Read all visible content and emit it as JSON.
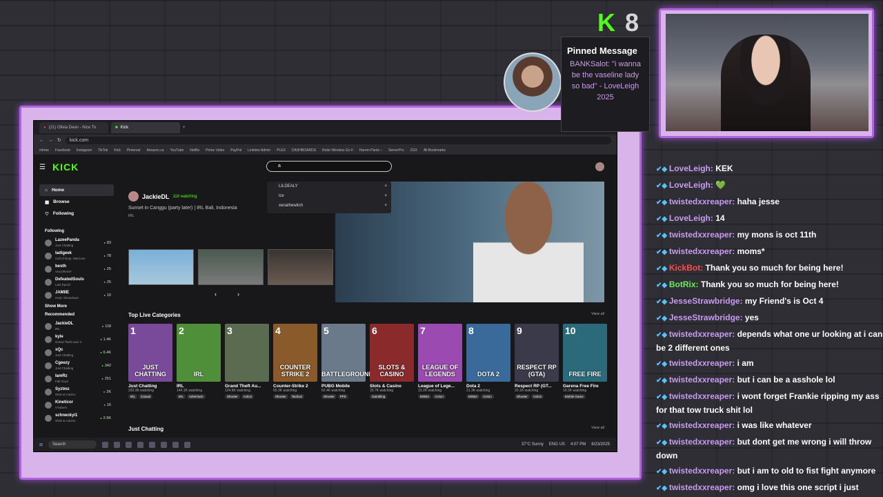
{
  "overlay": {
    "kick_logo_letter": "K",
    "viewer_count": "8",
    "pinned": {
      "title": "Pinned Message",
      "text": "BANKSalot: \"i wanna be the vaseline lady so bad\" - LoveLeigh 2025"
    }
  },
  "browser": {
    "tabs": [
      {
        "label": "(21) Olivia Dean - Nice To"
      },
      {
        "label": "Kick"
      }
    ],
    "url": "kick.com",
    "bookmarks": [
      "mhme",
      "Facebook",
      "Instagram",
      "TikTok",
      "Kick",
      "Pinterest",
      "Amazon.ca",
      "YouTube",
      "Netflix",
      "Prime Video",
      "PayPal",
      "Linktree Admin",
      "PLEX",
      "DASHBOARDS",
      "Rode Wireless Go II",
      "Harem Pants –",
      "ServerPro",
      "ZGX",
      "All Bookmarks"
    ]
  },
  "kick": {
    "logo": "KICK",
    "search_value": "a",
    "search_suggestions": [
      "LILDEALY",
      "ice",
      "xenathewitch"
    ],
    "nav": [
      "Home",
      "Browse",
      "Following"
    ],
    "following_header": "Following",
    "following": [
      {
        "name": "LazeePanda",
        "game": "Just Chatting",
        "count": "83"
      },
      {
        "name": "ladigeek",
        "game": "Call of Duty: Warzone",
        "count": "78"
      },
      {
        "name": "besth",
        "game": "VALORANT",
        "count": "25"
      },
      {
        "name": "DefeatedSouls",
        "game": "Last Epoch",
        "count": "25"
      },
      {
        "name": "JAMIIE",
        "game": "Hunt: Showdown",
        "count": "10"
      }
    ],
    "show_more": "Show More",
    "recommended_header": "Recommended",
    "recommended": [
      {
        "name": "JackieDL",
        "game": "IRL",
        "count": "118"
      },
      {
        "name": "kyle",
        "game": "Grand Theft Auto V",
        "count": "1.4K"
      },
      {
        "name": "xQc",
        "game": "Just Chatting",
        "count": "6.4K"
      },
      {
        "name": "Cgeezy",
        "game": "Just Chatting",
        "count": "342"
      },
      {
        "name": "IamRz",
        "game": "Fall Guys",
        "count": "251"
      },
      {
        "name": "Syztmz",
        "game": "Slots & Casino",
        "count": "2K"
      },
      {
        "name": "Kineticor",
        "game": "VTubers",
        "count": "16"
      },
      {
        "name": "schneckyi1",
        "game": "Slots & Casino",
        "count": "2.9K"
      }
    ],
    "featured": {
      "streamer": "JackieDL",
      "watching": "118 watching",
      "title": "Sunset in Canggu (party later) | IRL Bali, Indonesia",
      "category": "IRL"
    },
    "top_categories_title": "Top Live Categories",
    "view_all": "View all",
    "categories": [
      {
        "rank": "1",
        "art": "JUST CHATTING",
        "name": "Just Chatting",
        "viewers": "220.3K watching",
        "tags": [
          "IRL",
          "Casual"
        ],
        "color": "#7a4a9a"
      },
      {
        "rank": "2",
        "art": "IRL",
        "name": "IRL",
        "viewers": "144.1K watching",
        "tags": [
          "IRL",
          "Adventure"
        ],
        "color": "#4f8f3a"
      },
      {
        "rank": "3",
        "art": "",
        "name": "Grand Theft Au...",
        "viewers": "124.8K watching",
        "tags": [
          "Shooter",
          "Action"
        ],
        "color": "#5a6b50"
      },
      {
        "rank": "4",
        "art": "COUNTER STRIKE 2",
        "name": "Counter-Strike 2",
        "viewers": "65.3K watching",
        "tags": [
          "Shooter",
          "Tactical"
        ],
        "color": "#8a5a2a"
      },
      {
        "rank": "5",
        "art": "BATTLEGROUNDS",
        "name": "PUBG Mobile",
        "viewers": "62.4K watching",
        "tags": [
          "Shooter",
          "FPS"
        ],
        "color": "#6b7a8a"
      },
      {
        "rank": "6",
        "art": "SLOTS & CASINO",
        "name": "Slots & Casino",
        "viewers": "33.7K watching",
        "tags": [
          "Gambling"
        ],
        "color": "#8a2a2a"
      },
      {
        "rank": "7",
        "art": "LEAGUE OF LEGENDS",
        "name": "League of Lege...",
        "viewers": "33.2K watching",
        "tags": [
          "MOBA",
          "Action"
        ],
        "color": "#9a4ab0"
      },
      {
        "rank": "8",
        "art": "DOTA 2",
        "name": "Dota 2",
        "viewers": "21.3K watching",
        "tags": [
          "MOBA",
          "Action"
        ],
        "color": "#3a6a9a"
      },
      {
        "rank": "9",
        "art": "RESPECT RP (GTA)",
        "name": "Respect RP (GT...",
        "viewers": "20.1K watching",
        "tags": [
          "Shooter",
          "Action"
        ],
        "color": "#3a3a4a"
      },
      {
        "rank": "10",
        "art": "FREE FIRE",
        "name": "Garena Free Fire",
        "viewers": "19.2K watching",
        "tags": [
          "Mobile Game"
        ],
        "color": "#2a6a7a"
      }
    ],
    "just_chatting_title": "Just Chatting"
  },
  "taskbar": {
    "search": "Search",
    "weather": "37°C Sunny",
    "lang": "ENG US",
    "time": "4:07 PM",
    "date": "8/23/2025"
  },
  "chat": [
    {
      "user": "LoveLeigh:",
      "text": "KEK",
      "cls": ""
    },
    {
      "user": "LoveLeigh:",
      "text": "💚",
      "cls": ""
    },
    {
      "user": "twistedxxreaper:",
      "text": "haha jesse",
      "cls": ""
    },
    {
      "user": "LoveLeigh:",
      "text": "14",
      "cls": ""
    },
    {
      "user": "twistedxxreaper:",
      "text": "my mons is oct 11th",
      "cls": ""
    },
    {
      "user": "twistedxxreaper:",
      "text": "moms*",
      "cls": ""
    },
    {
      "user": "KickBot:",
      "text": "Thank you so much for being here!",
      "cls": "red"
    },
    {
      "user": "BotRix:",
      "text": "Thank you so much for being here!",
      "cls": "green"
    },
    {
      "user": "JesseStrawbridge:",
      "text": "my Friend's is Oct 4",
      "cls": ""
    },
    {
      "user": "JesseStrawbridge:",
      "text": "yes",
      "cls": ""
    },
    {
      "user": "twistedxxreaper:",
      "text": "depends what one ur looking at i can be 2 different ones",
      "cls": ""
    },
    {
      "user": "twistedxxreaper:",
      "text": "i am",
      "cls": ""
    },
    {
      "user": "twistedxxreaper:",
      "text": "but i can be a asshole lol",
      "cls": ""
    },
    {
      "user": "twistedxxreaper:",
      "text": "i wont forget Frankie ripping my ass for that tow truck shit lol",
      "cls": ""
    },
    {
      "user": "twistedxxreaper:",
      "text": "i was like whatever",
      "cls": ""
    },
    {
      "user": "twistedxxreaper:",
      "text": "but dont get me wrong i will throw down",
      "cls": ""
    },
    {
      "user": "twistedxxreaper:",
      "text": "but i am to old to fist fight anymore",
      "cls": ""
    },
    {
      "user": "twistedxxreaper:",
      "text": "omg i love this one script i just found u can make posters and shit and post them in city",
      "cls": ""
    }
  ]
}
